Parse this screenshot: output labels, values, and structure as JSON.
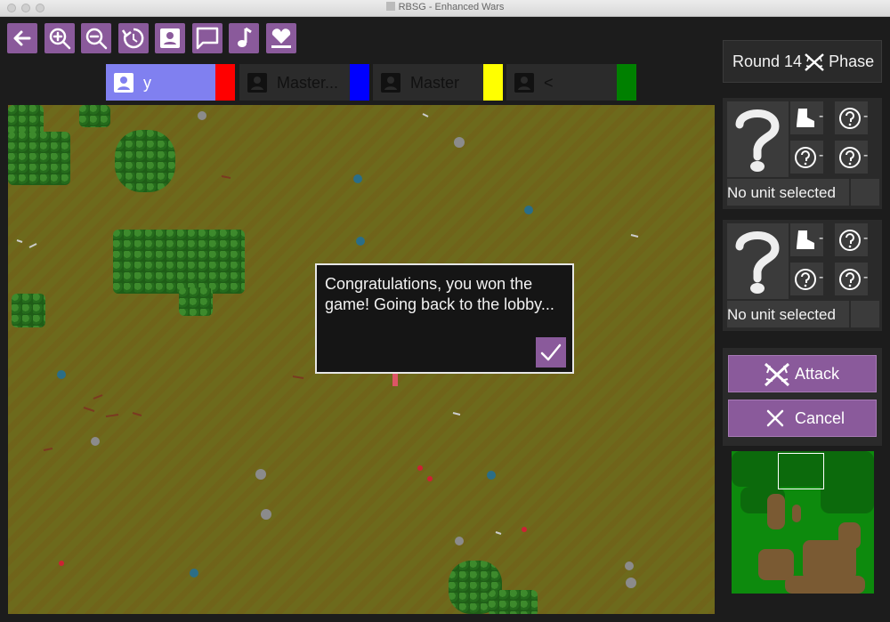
{
  "window": {
    "title": "RBSG - Enhanced Wars"
  },
  "toolbar": {
    "icons": [
      "back-arrow-icon",
      "zoom-in-icon",
      "zoom-out-icon",
      "rotate-icon",
      "profile-icon",
      "chat-icon",
      "music-note-icon",
      "health-heart-icon"
    ]
  },
  "players": [
    {
      "name": "y",
      "color": "#ff0000",
      "active": true
    },
    {
      "name": "Master...",
      "color": "#0000ff",
      "active": false
    },
    {
      "name": "Master",
      "color": "#ffff00",
      "active": false
    },
    {
      "name": "<",
      "color": "#008000",
      "active": false
    }
  ],
  "dialog": {
    "message": "Congratulations, you won the game! Going back to the lobby...",
    "confirm_icon": "checkmark-icon"
  },
  "round": {
    "round_label": "Round 14",
    "phase_label": "Phase",
    "phase_icon": "crossed-swords-icon"
  },
  "unit_cards": [
    {
      "status": "No unit selected",
      "stats": [
        {
          "icon": "boot-icon",
          "value": "-"
        },
        {
          "icon": "question-icon",
          "value": "-"
        },
        {
          "icon": "question-icon",
          "value": "-"
        },
        {
          "icon": "question-icon",
          "value": "-"
        }
      ]
    },
    {
      "status": "No unit selected",
      "stats": [
        {
          "icon": "boot-icon",
          "value": "-"
        },
        {
          "icon": "question-icon",
          "value": "-"
        },
        {
          "icon": "question-icon",
          "value": "-"
        },
        {
          "icon": "question-icon",
          "value": "-"
        }
      ]
    }
  ],
  "actions": {
    "attack_label": "Attack",
    "cancel_label": "Cancel"
  },
  "colors": {
    "accent": "#8a5a9b",
    "active_player": "#8080f0",
    "grass": "#6d6a1c",
    "minimap_grass": "#0d8a0d"
  }
}
